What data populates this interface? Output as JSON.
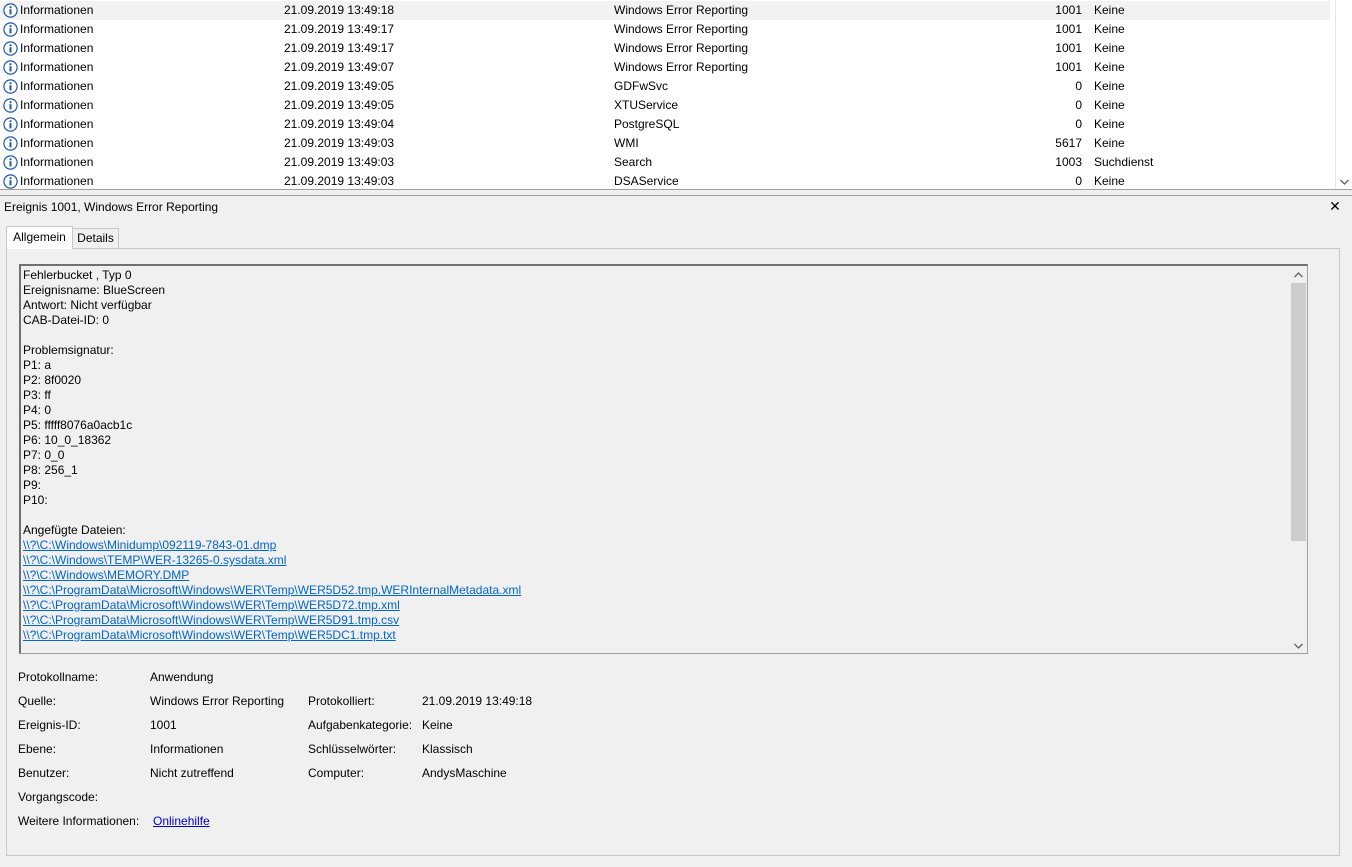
{
  "events": [
    {
      "level": "Informationen",
      "date": "21.09.2019 13:49:18",
      "source": "Windows Error Reporting",
      "id": "1001",
      "category": "Keine"
    },
    {
      "level": "Informationen",
      "date": "21.09.2019 13:49:17",
      "source": "Windows Error Reporting",
      "id": "1001",
      "category": "Keine"
    },
    {
      "level": "Informationen",
      "date": "21.09.2019 13:49:17",
      "source": "Windows Error Reporting",
      "id": "1001",
      "category": "Keine"
    },
    {
      "level": "Informationen",
      "date": "21.09.2019 13:49:07",
      "source": "Windows Error Reporting",
      "id": "1001",
      "category": "Keine"
    },
    {
      "level": "Informationen",
      "date": "21.09.2019 13:49:05",
      "source": "GDFwSvc",
      "id": "0",
      "category": "Keine"
    },
    {
      "level": "Informationen",
      "date": "21.09.2019 13:49:05",
      "source": "XTUService",
      "id": "0",
      "category": "Keine"
    },
    {
      "level": "Informationen",
      "date": "21.09.2019 13:49:04",
      "source": "PostgreSQL",
      "id": "0",
      "category": "Keine"
    },
    {
      "level": "Informationen",
      "date": "21.09.2019 13:49:03",
      "source": "WMI",
      "id": "5617",
      "category": "Keine"
    },
    {
      "level": "Informationen",
      "date": "21.09.2019 13:49:03",
      "source": "Search",
      "id": "1003",
      "category": "Suchdienst"
    },
    {
      "level": "Informationen",
      "date": "21.09.2019 13:49:03",
      "source": "DSAService",
      "id": "0",
      "category": "Keine"
    }
  ],
  "detail": {
    "title": "Ereignis 1001, Windows Error Reporting",
    "close_symbol": "✕",
    "tabs": {
      "general": "Allgemein",
      "details": "Details"
    },
    "description_lines": [
      "Fehlerbucket , Typ 0",
      "Ereignisname: BlueScreen",
      "Antwort: Nicht verfügbar",
      "CAB-Datei-ID: 0",
      "",
      "Problemsignatur:",
      "P1: a",
      "P2: 8f0020",
      "P3: ff",
      "P4: 0",
      "P5: fffff8076a0acb1c",
      "P6: 10_0_18362",
      "P7: 0_0",
      "P8: 256_1",
      "P9: ",
      "P10: ",
      "",
      "Angefügte Dateien:"
    ],
    "attached_files": [
      "\\\\?\\C:\\Windows\\Minidump\\092119-7843-01.dmp",
      "\\\\?\\C:\\Windows\\TEMP\\WER-13265-0.sysdata.xml",
      "\\\\?\\C:\\Windows\\MEMORY.DMP",
      "\\\\?\\C:\\ProgramData\\Microsoft\\Windows\\WER\\Temp\\WER5D52.tmp.WERInternalMetadata.xml",
      "\\\\?\\C:\\ProgramData\\Microsoft\\Windows\\WER\\Temp\\WER5D72.tmp.xml",
      "\\\\?\\C:\\ProgramData\\Microsoft\\Windows\\WER\\Temp\\WER5D91.tmp.csv",
      "\\\\?\\C:\\ProgramData\\Microsoft\\Windows\\WER\\Temp\\WER5DC1.tmp.txt"
    ],
    "properties": {
      "log_name_label": "Protokollname:",
      "log_name": "Anwendung",
      "source_label": "Quelle:",
      "source": "Windows Error Reporting",
      "logged_label": "Protokolliert:",
      "logged": "21.09.2019 13:49:18",
      "event_id_label": "Ereignis-ID:",
      "event_id": "1001",
      "task_category_label": "Aufgabenkategorie:",
      "task_category": "Keine",
      "level_label": "Ebene:",
      "level": "Informationen",
      "keywords_label": "Schlüsselwörter:",
      "keywords": "Klassisch",
      "user_label": "Benutzer:",
      "user": "Nicht zutreffend",
      "computer_label": "Computer:",
      "computer": "AndysMaschine",
      "opcode_label": "Vorgangscode:",
      "more_info_label": "Weitere Informationen:",
      "more_info_link": "Onlinehilfe"
    }
  },
  "colors": {
    "link": "#0066cc",
    "info_icon": "#1e5aa8"
  },
  "icons": {
    "level": "info-icon",
    "close": "close-icon",
    "scroll_up": "chevron-up-icon",
    "scroll_down": "chevron-down-icon"
  }
}
